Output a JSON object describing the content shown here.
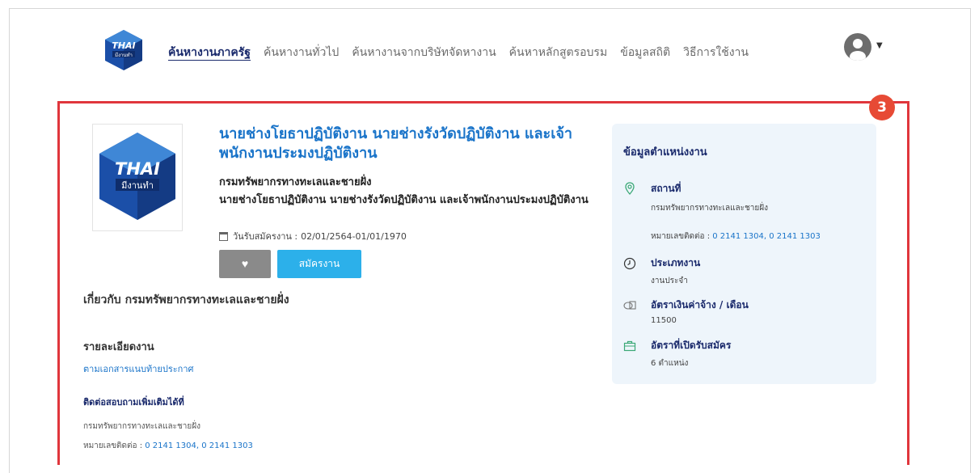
{
  "nav": {
    "logo_text": "THAI มีงานทำ",
    "links": [
      "ค้นหางานภาครัฐ",
      "ค้นหางานทั่วไป",
      "ค้นหางานจากบริษัทจัดหางาน",
      "ค้นหาหลักสูตรอบรม",
      "ข้อมูลสถิติ",
      "วิธีการใช้งาน"
    ]
  },
  "annotation": {
    "badge": "3"
  },
  "job": {
    "title": "นายช่างโยธาปฏิบัติงาน นายช่างรังวัดปฏิบัติงาน และเจ้าพนักงานประมงปฏิบัติงาน",
    "company": "กรมทรัพยากรทางทะเลและชายฝั่ง",
    "position": "นายช่างโยธาปฏิบัติงาน นายช่างรังวัดปฏิบัติงาน และเจ้าพนักงานประมงปฏิบัติงาน",
    "apply_date_label": "วันรับสมัครงาน :",
    "apply_date": "02/01/2564-01/01/1970",
    "apply_label": "สมัครงาน",
    "about": "เกี่ยวกับ กรมทรัพยากรทางทะเลและชายฝั่ง",
    "details_heading": "รายละเอียดงาน",
    "details_value": "ตามเอกสารแนบท้ายประกาศ",
    "contact_heading": "ติดต่อสอบถามเพิ่มเติมได้ที่",
    "contact_company": "กรมทรัพยากรทางทะเลและชายฝั่ง",
    "contact_phone_label": "หมายเลขติดต่อ :",
    "contact_phone": "0 2141 1304, 0 2141 1303"
  },
  "panel": {
    "title": "ข้อมูลตำแหน่งงาน",
    "location_label": "สถานที่",
    "location_value": "กรมทรัพยากรทางทะเลและชายฝั่ง",
    "phone_label": "หมายเลขติดต่อ :",
    "phone_value": "0 2141 1304, 0 2141 1303",
    "type_label": "ประเภทงาน",
    "type_value": "งานประจำ",
    "salary_label": "อัตราเงินค่าจ้าง / เดือน",
    "salary_value": "11500",
    "openings_label": "อัตราที่เปิดรับสมัคร",
    "openings_value": "6 ตำแหน่ง"
  },
  "colors": {
    "brand": "#1a2a6c",
    "link": "#1a74c9",
    "apply": "#2cb0ea",
    "highlight": "#e0363c"
  }
}
